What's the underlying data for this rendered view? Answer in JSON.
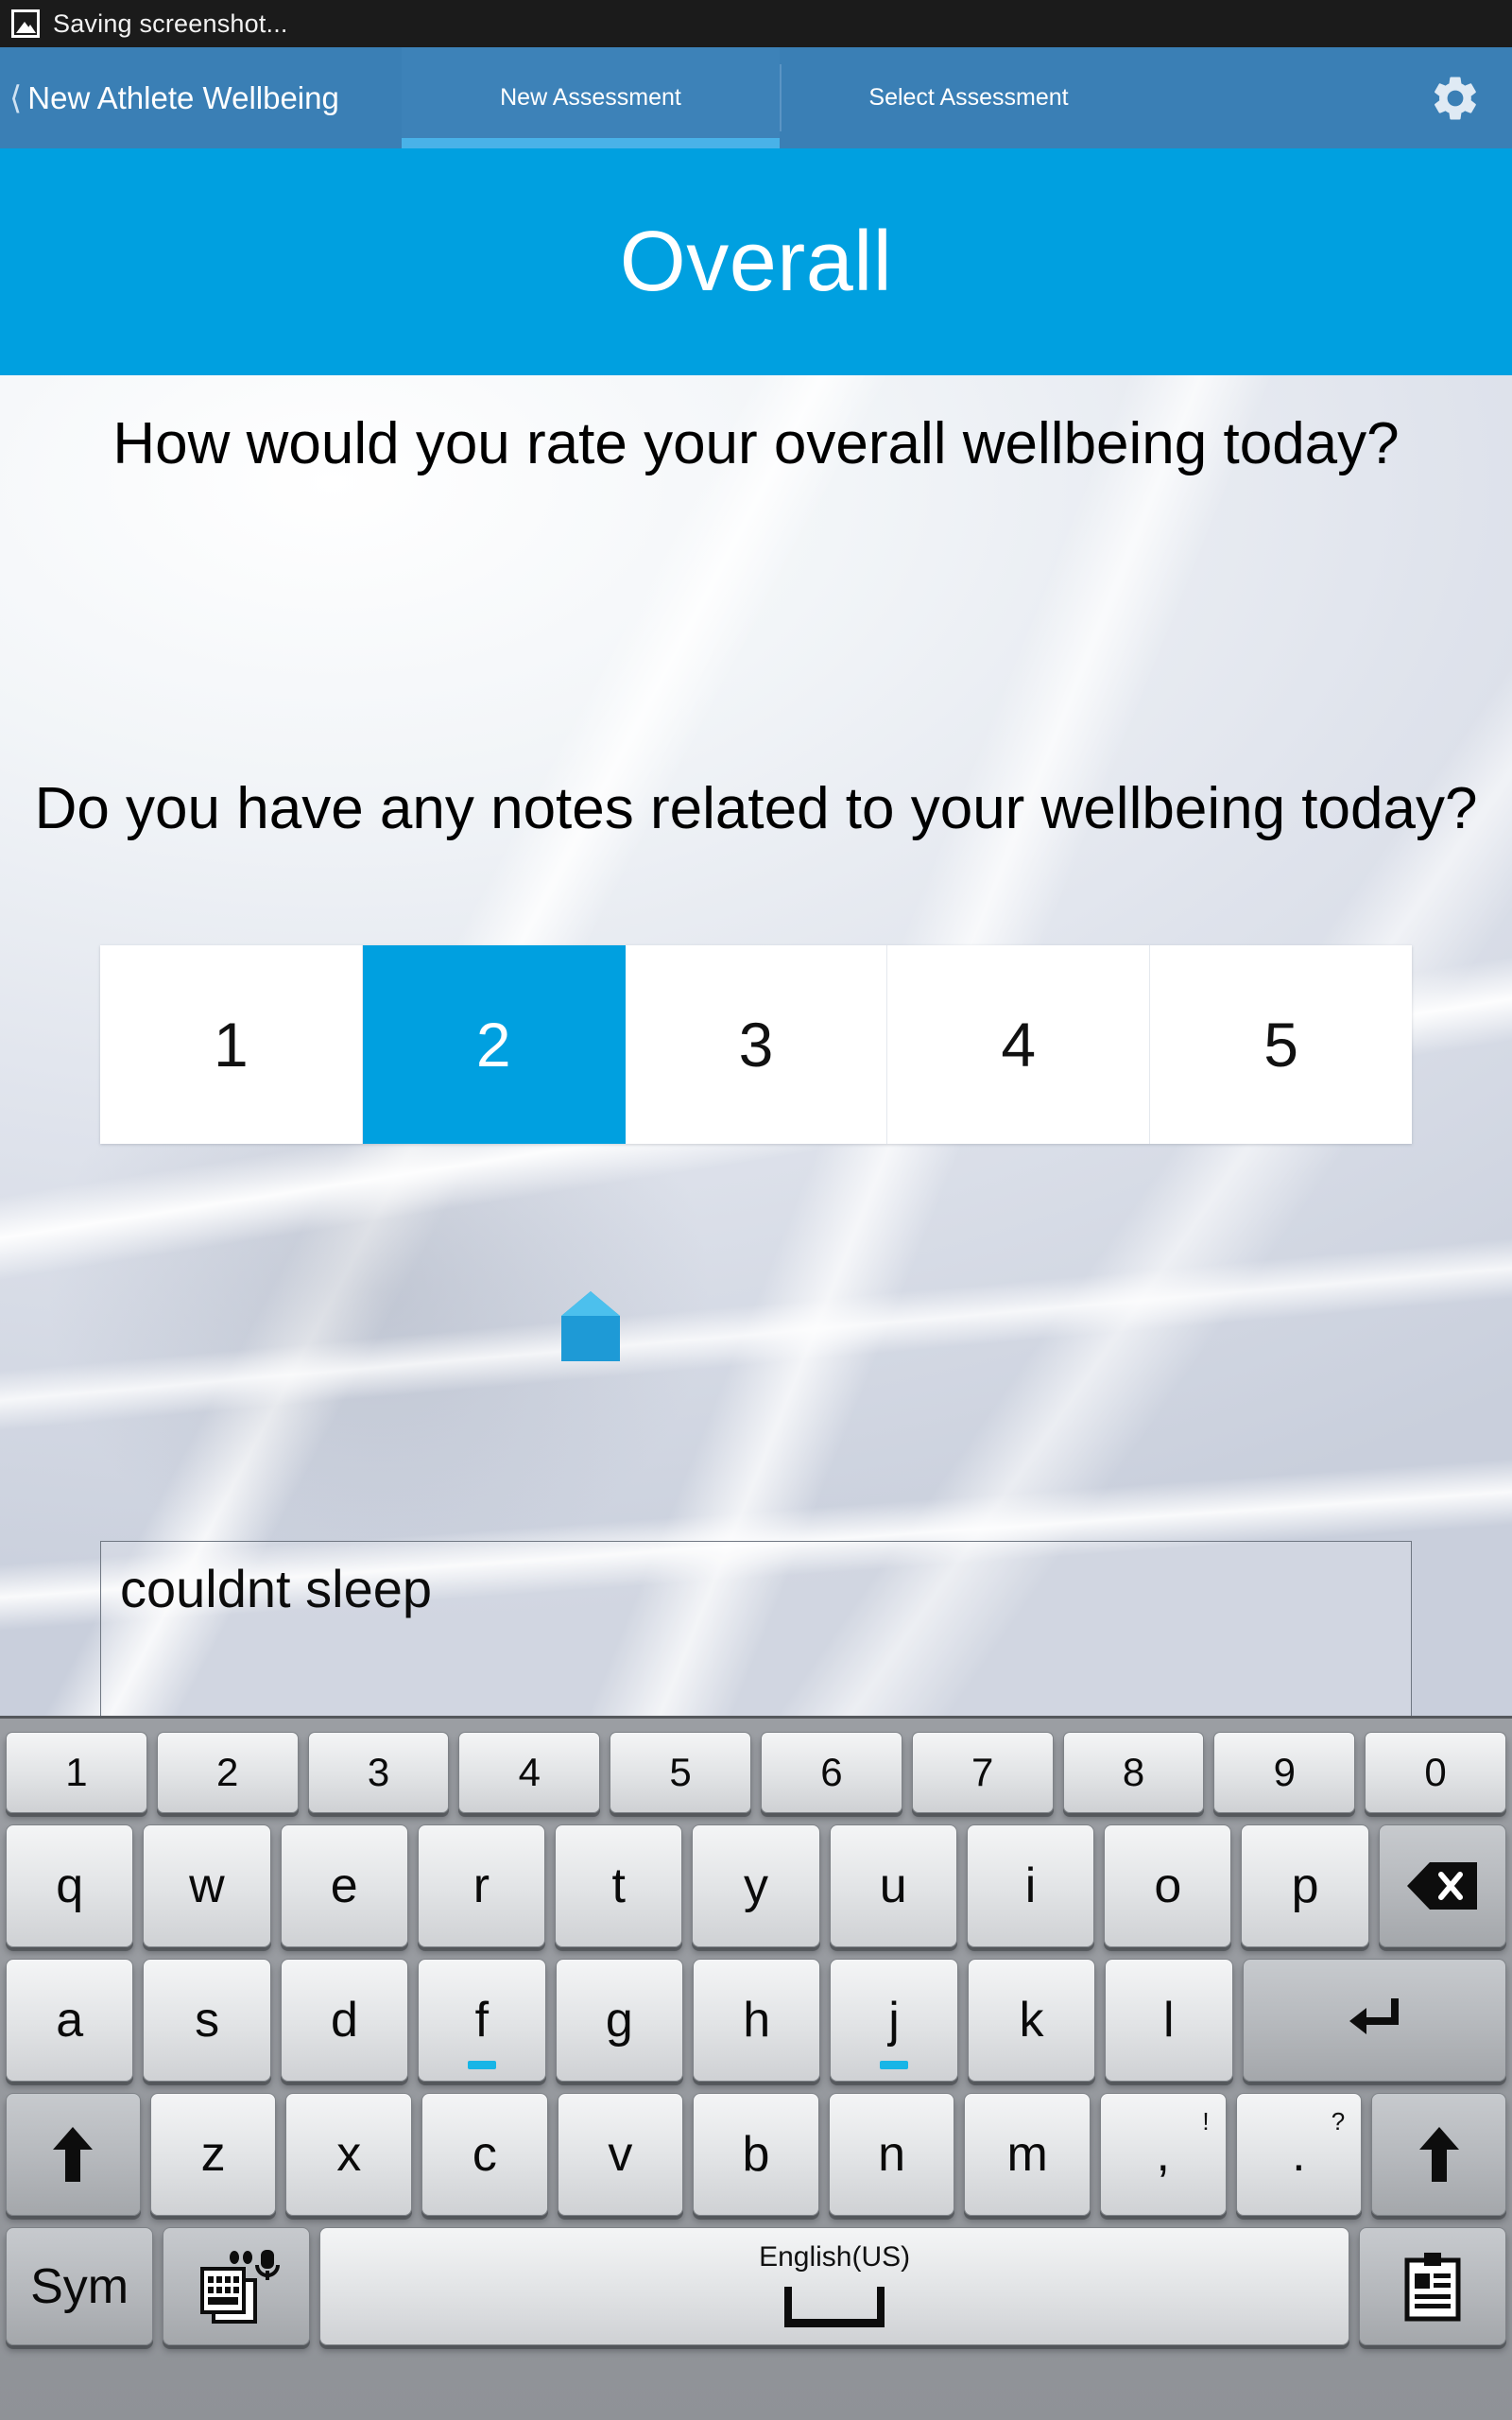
{
  "status_bar": {
    "icon": "image-icon",
    "text": "Saving screenshot..."
  },
  "nav": {
    "back_label": "New Athlete Wellbeing",
    "back_icon": "chevron-left-icon",
    "tabs": [
      {
        "label": "New Assessment",
        "active": true
      },
      {
        "label": "Select Assessment",
        "active": false
      }
    ],
    "settings_icon": "gear-icon"
  },
  "header": {
    "title": "Overall",
    "background": "#00a0e0"
  },
  "main": {
    "question_1": "How would you rate your overall wellbeing today?",
    "rating": {
      "options": [
        "1",
        "2",
        "3",
        "4",
        "5"
      ],
      "selected": "2",
      "selected_color": "#00a0e0"
    },
    "question_2": "Do you have any notes related to your wellbeing today?",
    "notes": {
      "value": "couldnt sleep",
      "placeholder": ""
    },
    "cursor_handle_icon": "text-cursor-handle-icon"
  },
  "keyboard": {
    "language": "English(US)",
    "row_numbers": [
      "1",
      "2",
      "3",
      "4",
      "5",
      "6",
      "7",
      "8",
      "9",
      "0"
    ],
    "row_top": [
      "q",
      "w",
      "e",
      "r",
      "t",
      "y",
      "u",
      "i",
      "o",
      "p"
    ],
    "backspace_icon": "backspace-icon",
    "row_home": [
      "a",
      "s",
      "d",
      "f",
      "g",
      "h",
      "j",
      "k",
      "l"
    ],
    "enter_icon": "enter-icon",
    "row_bottom": [
      "z",
      "x",
      "c",
      "v",
      "b",
      "n",
      "m"
    ],
    "shift_icon": "shift-up-arrow-icon",
    "punct_comma": {
      "main": ",",
      "alt": "!"
    },
    "punct_period": {
      "main": ".",
      "alt": "?"
    },
    "sym_label": "Sym",
    "input_method_icon": "keyboard-mic-switch-icon",
    "space_icon": "spacebar-glyph",
    "clipboard_icon": "clipboard-icon",
    "home_row_keys": [
      "f",
      "j"
    ]
  }
}
